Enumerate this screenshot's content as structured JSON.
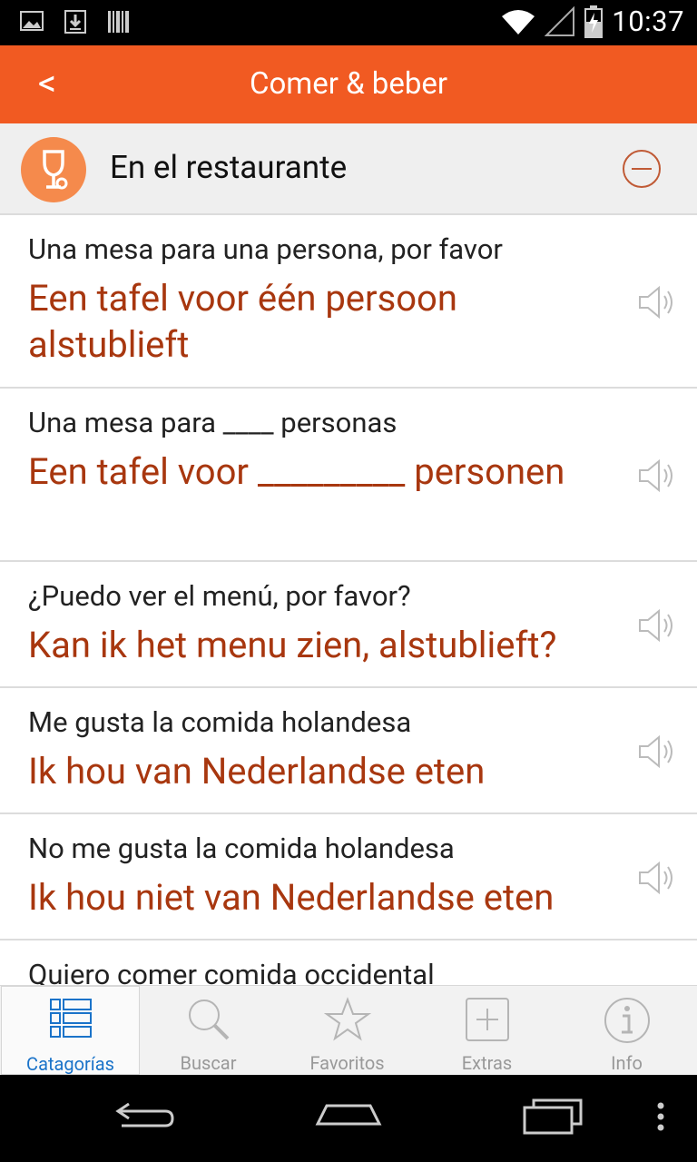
{
  "status_bar": {
    "time": "10:37"
  },
  "header": {
    "back_label": "<",
    "title": "Comer & beber"
  },
  "category": {
    "title": "En el restaurante",
    "icon": "wine-glass-icon"
  },
  "phrases": [
    {
      "es": "Una mesa para una persona, por favor",
      "nl": "Een tafel voor één persoon alstublieft"
    },
    {
      "es": "Una mesa para ____ personas",
      "nl": "Een tafel voor _________ personen"
    },
    {
      "es": "¿Puedo ver el menú, por favor?",
      "nl": "Kan ik het menu zien, alstublieft?"
    },
    {
      "es": "Me gusta la comida holandesa",
      "nl": "Ik hou van Nederlandse eten"
    },
    {
      "es": "No me gusta la comida holandesa",
      "nl": "Ik hou niet van Nederlandse eten"
    },
    {
      "es": "Quiero comer comida occidental",
      "nl": ""
    }
  ],
  "tabs": [
    {
      "label": "Catagorías",
      "icon": "categories-icon",
      "active": true
    },
    {
      "label": "Buscar",
      "icon": "search-icon",
      "active": false
    },
    {
      "label": "Favoritos",
      "icon": "star-icon",
      "active": false
    },
    {
      "label": "Extras",
      "icon": "plus-square-icon",
      "active": false
    },
    {
      "label": "Info",
      "icon": "info-icon",
      "active": false
    }
  ],
  "colors": {
    "accent": "#f15a22",
    "phrase_translation": "#a8370f",
    "active_tab": "#1a73c9"
  }
}
